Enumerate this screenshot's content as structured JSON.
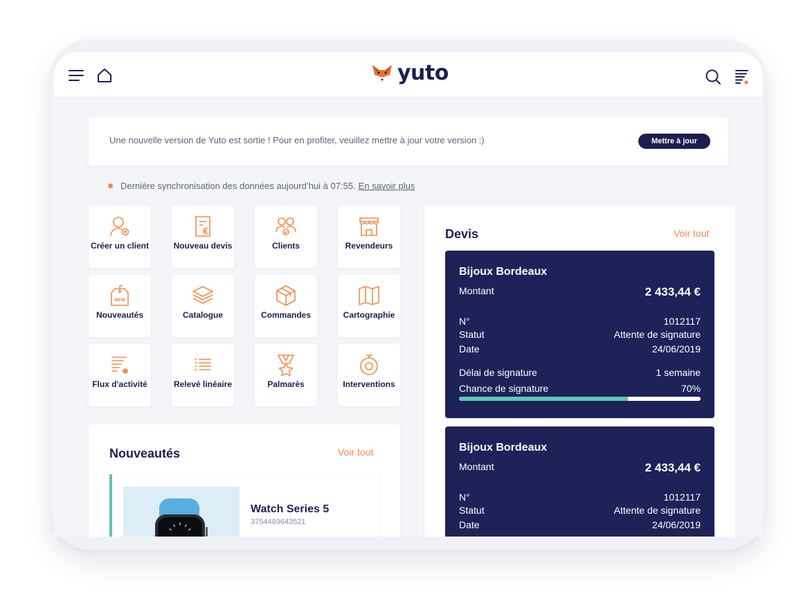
{
  "app": {
    "logo_text": "yuto",
    "brand_color": "#1d1f52",
    "accent_color": "#f38b4a",
    "success_color": "#5ec6b6"
  },
  "header": {
    "menu_icon": "hamburger-icon",
    "home_icon": "home-icon",
    "search_icon": "search-icon",
    "filter_icon": "filter-list-icon"
  },
  "banner": {
    "message": "Une nouvelle version de Yuto est sortie ! Pour en profiter, veuillez mettre à jour votre version :)",
    "button_label": "Mettre à jour"
  },
  "sync": {
    "text": "Dernière synchronisation des données aujourd’hui à 07:55.",
    "link": "En savoir plus"
  },
  "tiles": [
    {
      "label": "Créer un client",
      "icon": "user-plus-icon"
    },
    {
      "label": "Nouveau devis",
      "icon": "quote-euro-icon"
    },
    {
      "label": "Clients",
      "icon": "clients-icon"
    },
    {
      "label": "Revendeurs",
      "icon": "store-icon"
    },
    {
      "label": "Nouveautés",
      "icon": "new-tag-icon"
    },
    {
      "label": "Catalogue",
      "icon": "layers-icon"
    },
    {
      "label": "Commandes",
      "icon": "box-icon"
    },
    {
      "label": "Cartographie",
      "icon": "map-icon"
    },
    {
      "label": "Flux d'activité",
      "icon": "activity-feed-icon"
    },
    {
      "label": "Relevé linéaire",
      "icon": "list-icon"
    },
    {
      "label": "Palmarès",
      "icon": "medal-icon"
    },
    {
      "label": "Interventions",
      "icon": "stopwatch-icon"
    }
  ],
  "news": {
    "title": "Nouveautés",
    "see_all": "Voir tout",
    "product": {
      "name": "Watch Series 5",
      "ref": "3754489643521"
    }
  },
  "quotes": {
    "title": "Devis",
    "see_all": "Voir tout",
    "items": [
      {
        "client": "Bijoux Bordeaux",
        "amount_label": "Montant",
        "amount": "2 433,44 €",
        "number_label": "N°",
        "number": "1012117",
        "status_label": "Statut",
        "status": "Attente de signature",
        "date_label": "Date",
        "date": "24/06/2019",
        "delay_label": "Délai de signature",
        "delay": "1 semaine",
        "chance_label": "Chance de signature",
        "chance": "70%",
        "chance_value": 0.7
      },
      {
        "client": "Bijoux Bordeaux",
        "amount_label": "Montant",
        "amount": "2 433,44 €",
        "number_label": "N°",
        "number": "1012117",
        "status_label": "Statut",
        "status": "Attente de signature",
        "date_label": "Date",
        "date": "24/06/2019"
      }
    ]
  }
}
